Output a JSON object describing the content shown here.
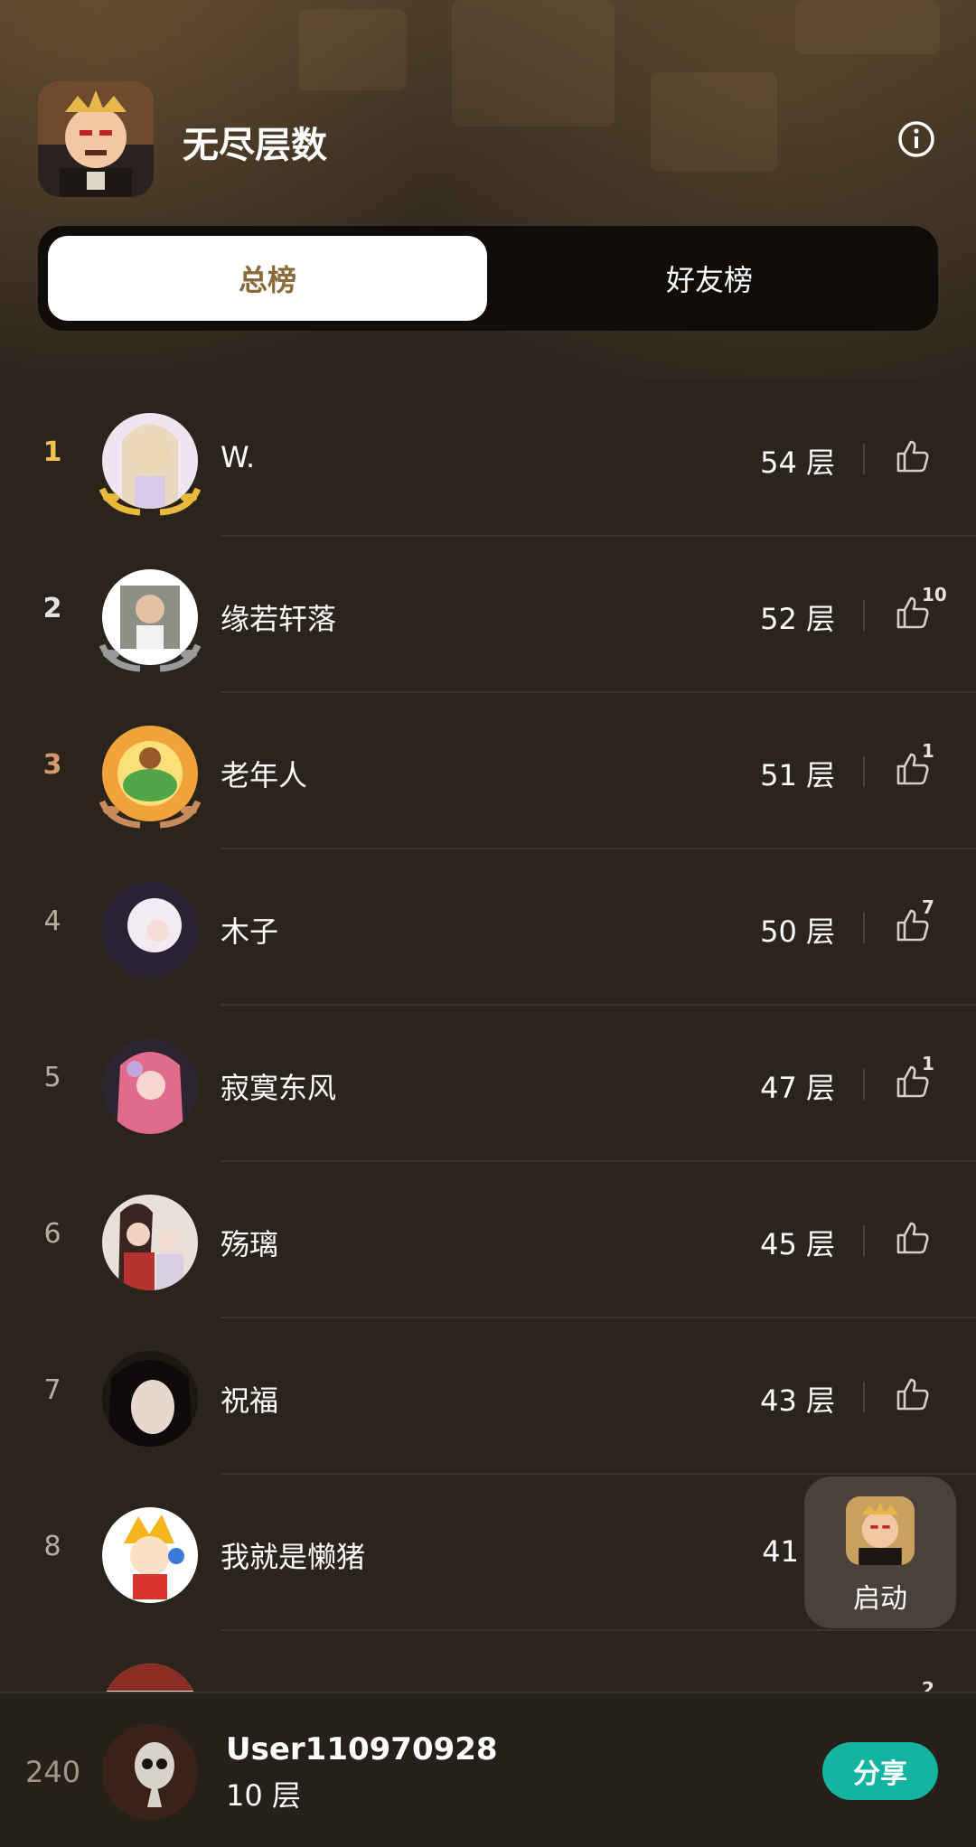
{
  "header": {
    "title": "无尽层数",
    "info_icon": "info-icon",
    "app_icon": "game-king-icon"
  },
  "tabs": [
    {
      "label": "总榜",
      "active": true
    },
    {
      "label": "好友榜",
      "active": false
    }
  ],
  "leaderboard": [
    {
      "rank": "1",
      "name": "W.",
      "score": "54 层",
      "likes": "",
      "medal": "gold",
      "avatar_color": "#e9dff0"
    },
    {
      "rank": "2",
      "name": "缘若轩落",
      "score": "52 层",
      "likes": "10",
      "medal": "silver",
      "avatar_color": "#d8d8d8"
    },
    {
      "rank": "3",
      "name": "老年人",
      "score": "51 层",
      "likes": "1",
      "medal": "bronze",
      "avatar_color": "#f2a23a"
    },
    {
      "rank": "4",
      "name": "木子",
      "score": "50 层",
      "likes": "7",
      "medal": "",
      "avatar_color": "#efe7f1"
    },
    {
      "rank": "5",
      "name": "寂寞东风",
      "score": "47 层",
      "likes": "1",
      "medal": "",
      "avatar_color": "#e06b8c"
    },
    {
      "rank": "6",
      "name": "殇璃",
      "score": "45 层",
      "likes": "",
      "medal": "",
      "avatar_color": "#cfa7a2"
    },
    {
      "rank": "7",
      "name": "祝福",
      "score": "43 层",
      "likes": "",
      "medal": "",
      "avatar_color": "#1c1715"
    },
    {
      "rank": "8",
      "name": "我就是懒猪",
      "score": "41",
      "likes": "",
      "medal": "",
      "avatar_color": "#ffffff"
    },
    {
      "rank": "",
      "name": "",
      "score": "",
      "likes": "2",
      "medal": "",
      "avatar_color": "#f0e8e4"
    }
  ],
  "launch_button": {
    "label": "启动"
  },
  "current_user": {
    "rank": "240",
    "name": "User110970928",
    "score": "10 层",
    "share_label": "分享"
  }
}
